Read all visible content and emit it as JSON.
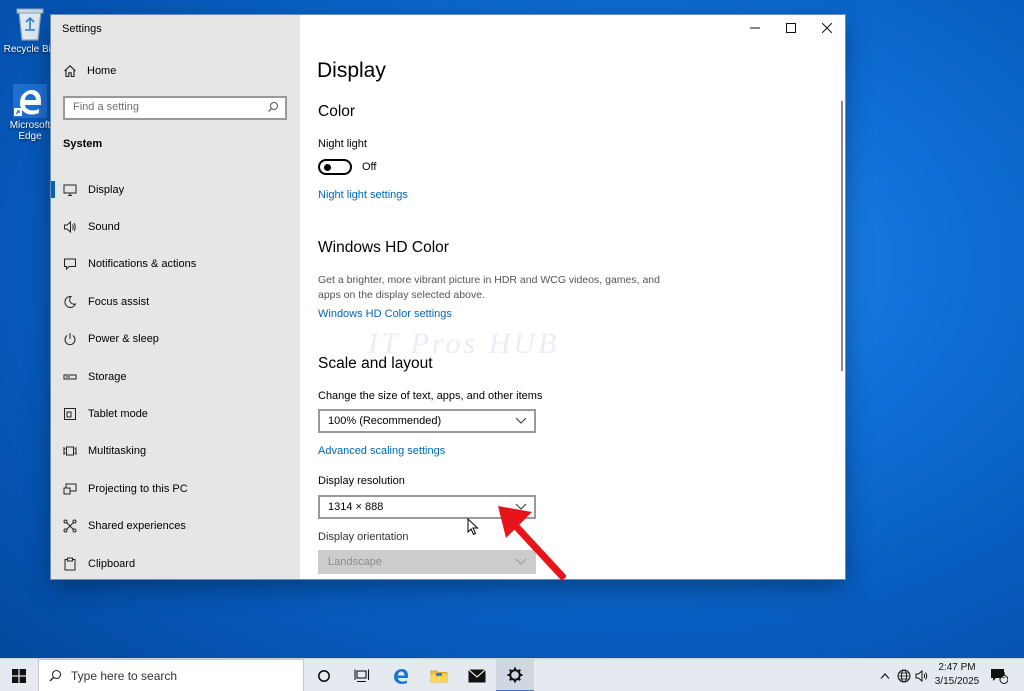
{
  "desktop": {
    "icons": [
      {
        "label": "Recycle Bin",
        "icon": "recycle-bin-icon"
      },
      {
        "label": "Microsoft Edge",
        "icon": "edge-icon"
      }
    ]
  },
  "window": {
    "title": "Settings",
    "controls": {
      "minimize": "minimize-icon",
      "maximize": "maximize-icon",
      "close": "close-icon"
    }
  },
  "sidebar": {
    "home_label": "Home",
    "search_placeholder": "Find a setting",
    "section_label": "System",
    "items": [
      {
        "label": "Display",
        "icon": "monitor-icon",
        "active": true
      },
      {
        "label": "Sound",
        "icon": "speaker-icon"
      },
      {
        "label": "Notifications & actions",
        "icon": "notification-icon"
      },
      {
        "label": "Focus assist",
        "icon": "moon-icon"
      },
      {
        "label": "Power & sleep",
        "icon": "power-icon"
      },
      {
        "label": "Storage",
        "icon": "storage-icon"
      },
      {
        "label": "Tablet mode",
        "icon": "tablet-icon"
      },
      {
        "label": "Multitasking",
        "icon": "multitasking-icon"
      },
      {
        "label": "Projecting to this PC",
        "icon": "projecting-icon"
      },
      {
        "label": "Shared experiences",
        "icon": "shared-icon"
      },
      {
        "label": "Clipboard",
        "icon": "clipboard-icon"
      }
    ]
  },
  "main": {
    "page_title": "Display",
    "color": {
      "heading": "Color",
      "night_light_label": "Night light",
      "night_light_state": "Off",
      "night_light_on": false,
      "night_light_settings_link": "Night light settings"
    },
    "hd_color": {
      "heading": "Windows HD Color",
      "description": "Get a brighter, more vibrant picture in HDR and WCG videos, games, and apps on the display selected above.",
      "settings_link": "Windows HD Color settings"
    },
    "watermark": "IT Pros HUB",
    "scale_layout": {
      "heading": "Scale and layout",
      "scale_label": "Change the size of text, apps, and other items",
      "scale_value": "100% (Recommended)",
      "advanced_link": "Advanced scaling settings",
      "resolution_label": "Display resolution",
      "resolution_value": "1314 × 888",
      "orientation_label": "Display orientation",
      "orientation_value": "Landscape",
      "orientation_disabled": true
    }
  },
  "taskbar": {
    "search_placeholder": "Type here to search",
    "icons": [
      "cortana-icon",
      "task-view-icon",
      "edge-icon",
      "file-explorer-icon",
      "mail-icon",
      "settings-gear-icon"
    ],
    "active_app": "settings-gear-icon",
    "tray_icons": [
      "chevron-up-icon",
      "network-icon",
      "volume-icon"
    ],
    "time": "2:47 PM",
    "date": "3/15/2025",
    "notification_count": "2"
  },
  "colors": {
    "accent": "#0063b1",
    "link": "#0067b8",
    "sidebar_bg": "#e6e6e6",
    "annotation_arrow": "#e8141c"
  }
}
